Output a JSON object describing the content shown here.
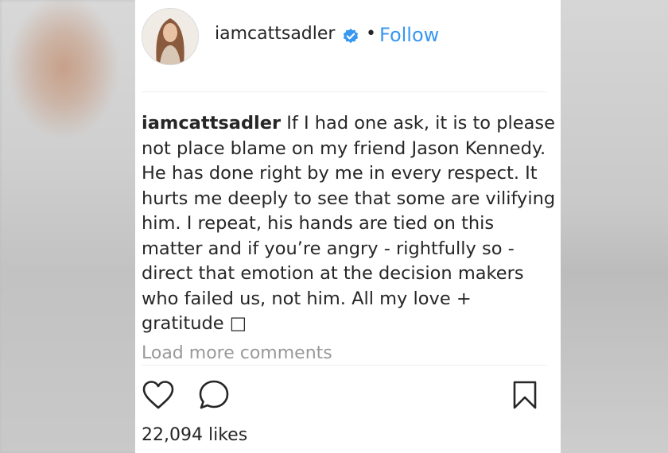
{
  "post": {
    "username": "iamcattsadler",
    "separator": "•",
    "follow_label": "Follow",
    "caption_username": "iamcattsadler",
    "caption_text": "If I had one ask, it is to please not place blame on my friend Jason Kennedy. He has done right by me in every respect. It hurts me deeply to see that some are vilifying him. I repeat, his hands are tied on this matter and if you’re angry - rightfully so - direct that emotion at the decision makers who failed us, not him. All my love + gratitude □",
    "load_more_label": "Load more comments",
    "likes_text": "22,094 likes"
  },
  "icons": {
    "verified": "verified-badge-icon",
    "like": "heart-icon",
    "comment": "comment-bubble-icon",
    "save": "bookmark-icon"
  },
  "colors": {
    "link": "#3897f0",
    "text": "#262626",
    "muted": "#999999"
  }
}
